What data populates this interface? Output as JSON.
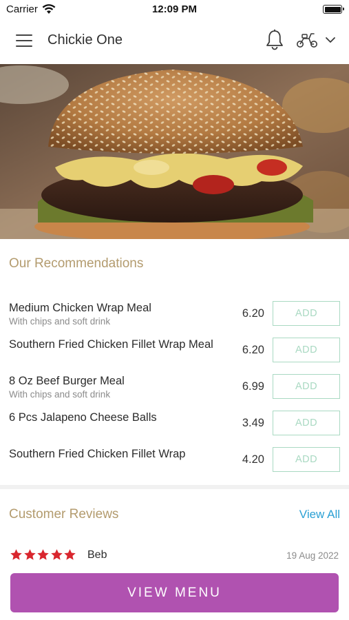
{
  "status_bar": {
    "carrier": "Carrier",
    "time": "12:09 PM"
  },
  "header": {
    "title": "Chickie One",
    "icons": [
      "menu-icon",
      "bell-icon",
      "scooter-icon",
      "chevron-down-icon"
    ]
  },
  "hero": {
    "icon": "burger-image"
  },
  "recommendations": {
    "title": "Our Recommendations",
    "items": [
      {
        "name": "Medium Chicken Wrap Meal",
        "description": "With chips and soft drink",
        "price": "6.20",
        "button": "ADD"
      },
      {
        "name": "Southern Fried Chicken Fillet Wrap Meal",
        "description": "",
        "price": "6.20",
        "button": "ADD"
      },
      {
        "name": "8 Oz Beef Burger Meal",
        "description": "With chips and soft drink",
        "price": "6.99",
        "button": "ADD"
      },
      {
        "name": "6 Pcs Jalapeno Cheese Balls",
        "description": "",
        "price": "3.49",
        "button": "ADD"
      },
      {
        "name": "Southern Fried Chicken Fillet Wrap",
        "description": "",
        "price": "4.20",
        "button": "ADD"
      }
    ]
  },
  "reviews": {
    "title": "Customer Reviews",
    "view_all": "View All",
    "items": [
      {
        "rating": 5,
        "name": "Beb",
        "date": "19 Aug 2022"
      }
    ]
  },
  "cta": {
    "label": "VIEW MENU"
  },
  "colors": {
    "accent": "#b052b0",
    "section_title": "#b39b6e",
    "add_button": "#a9d9c2",
    "link": "#2aa0d4",
    "stars": "#d9262e"
  }
}
